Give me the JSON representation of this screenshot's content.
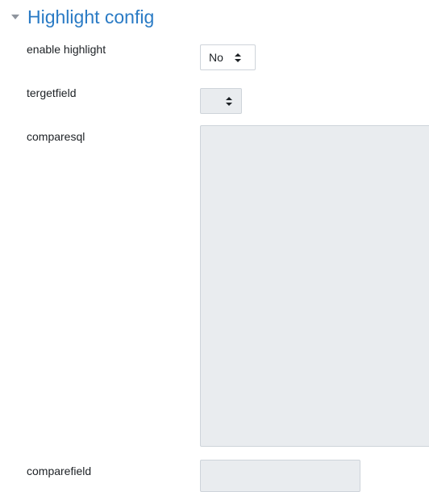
{
  "section": {
    "title": "Highlight config",
    "collapse_icon": "chevron-down-icon",
    "expanded": true
  },
  "fields": {
    "enable_highlight": {
      "label": "enable highlight",
      "value": "No",
      "icon": "updown-arrows-icon"
    },
    "tergetfield": {
      "label": "tergetfield",
      "value": "",
      "icon": "updown-arrows-icon"
    },
    "comparesql": {
      "label": "comparesql",
      "value": ""
    },
    "comparefield": {
      "label": "comparefield",
      "value": ""
    }
  },
  "colors": {
    "accent": "#2a7bc5",
    "disabled_bg": "#e9ecef",
    "border": "#ced4da"
  }
}
